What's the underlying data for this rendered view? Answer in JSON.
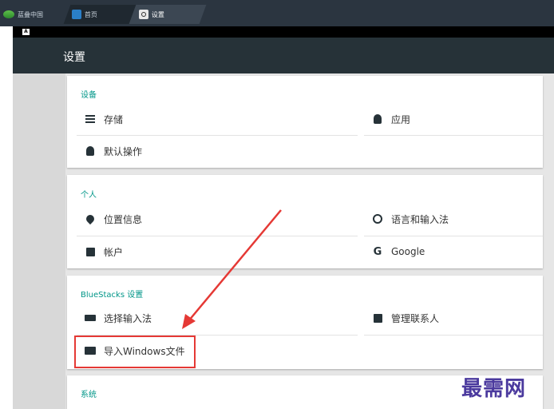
{
  "browser": {
    "tabs": [
      {
        "label": "蓝叠中国"
      },
      {
        "label": "首页"
      },
      {
        "label": "设置"
      }
    ]
  },
  "statusbar": {
    "badge": "A"
  },
  "appbar": {
    "title": "设置"
  },
  "sections": [
    {
      "title": "设备",
      "items": [
        {
          "label": "存储",
          "icon": "list-icon"
        },
        {
          "label": "应用",
          "icon": "android-icon"
        },
        {
          "label": "默认操作",
          "icon": "android-icon"
        }
      ]
    },
    {
      "title": "个人",
      "items": [
        {
          "label": "位置信息",
          "icon": "location-pin-icon"
        },
        {
          "label": "语言和输入法",
          "icon": "globe-icon"
        },
        {
          "label": "帐户",
          "icon": "account-box-icon"
        },
        {
          "label": "Google",
          "icon": "google-g-icon"
        }
      ]
    },
    {
      "title": "BlueStacks 设置",
      "items": [
        {
          "label": "选择输入法",
          "icon": "keyboard-icon"
        },
        {
          "label": "管理联系人",
          "icon": "contacts-icon"
        },
        {
          "label": "导入Windows文件",
          "icon": "folder-icon"
        }
      ]
    },
    {
      "title": "系统",
      "items": []
    }
  ],
  "annotation": {
    "color": "#e53935"
  },
  "watermark": "最需网",
  "colors": {
    "accent": "#009688",
    "appbar": "#263238",
    "tabbar": "#2b3540"
  }
}
